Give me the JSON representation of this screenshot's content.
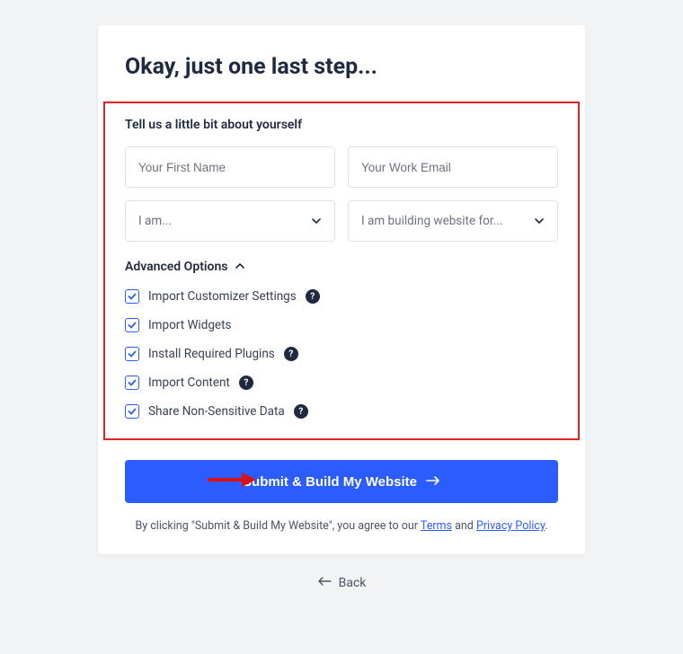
{
  "heading": "Okay, just one last step...",
  "section_label": "Tell us a little bit about yourself",
  "first_name": {
    "placeholder": "Your First Name",
    "value": ""
  },
  "work_email": {
    "placeholder": "Your Work Email",
    "value": ""
  },
  "role_select": {
    "placeholder": "I am..."
  },
  "building_for_select": {
    "placeholder": "I am building website for..."
  },
  "advanced_label": "Advanced Options",
  "options": {
    "import_customizer": {
      "label": "Import Customizer Settings",
      "help": true
    },
    "import_widgets": {
      "label": "Import Widgets",
      "help": false
    },
    "install_plugins": {
      "label": "Install Required Plugins",
      "help": true
    },
    "import_content": {
      "label": "Import Content",
      "help": true
    },
    "share_data": {
      "label": "Share Non-Sensitive Data",
      "help": true
    }
  },
  "submit_label": "Submit & Build My Website",
  "agree_prefix": "By clicking \"Submit & Build My Website\", you agree to our ",
  "agree_terms": "Terms",
  "agree_and": " and ",
  "agree_privacy": "Privacy Policy",
  "agree_suffix": ".",
  "back_label": "Back",
  "help_glyph": "?"
}
